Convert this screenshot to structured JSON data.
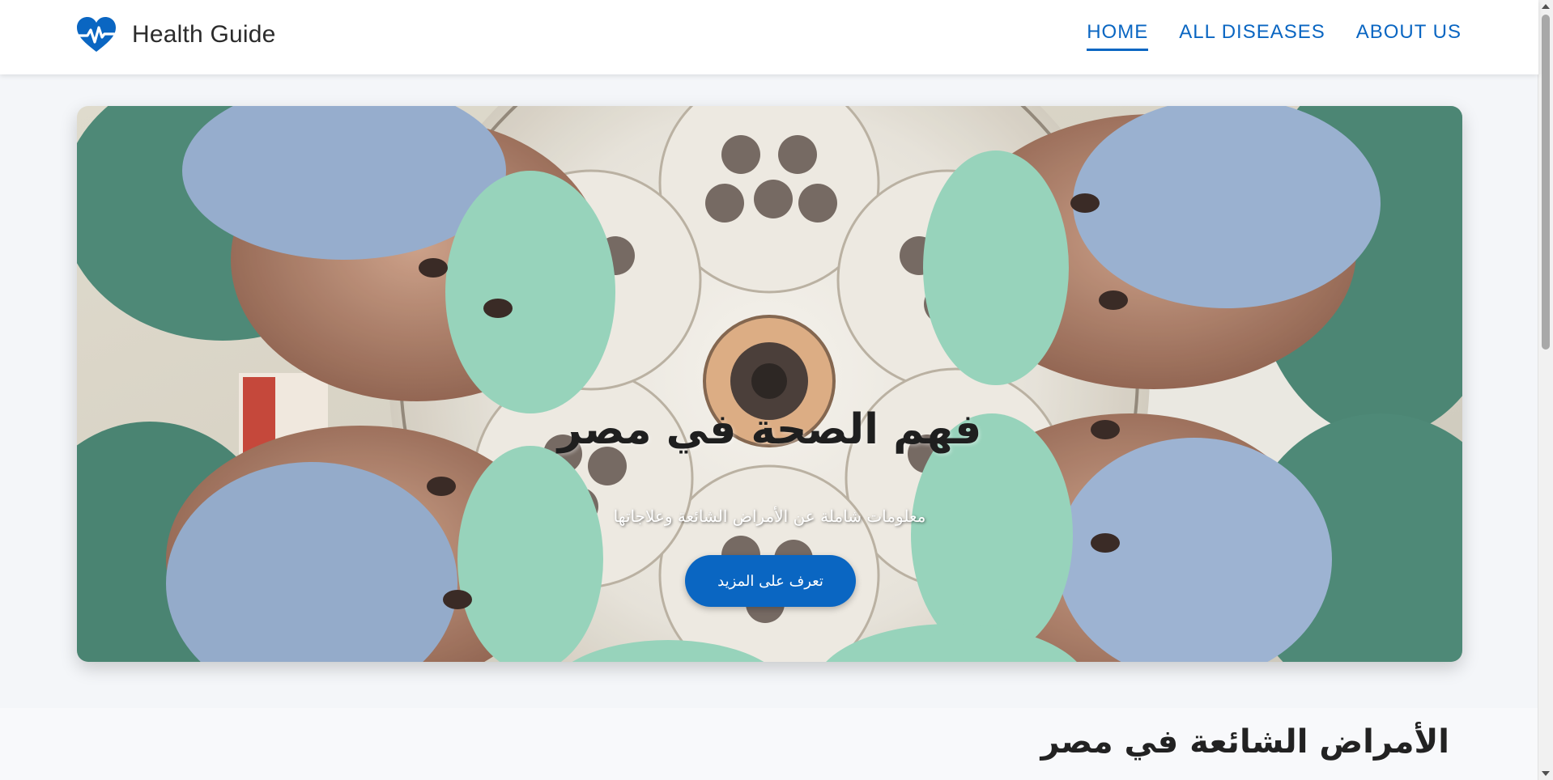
{
  "brand": {
    "name": "Health Guide",
    "icon": "heart-pulse-icon",
    "color": "#0a66c2"
  },
  "nav": {
    "items": [
      {
        "label": "HOME",
        "active": true
      },
      {
        "label": "ALL DISEASES",
        "active": false
      },
      {
        "label": "ABOUT US",
        "active": false
      }
    ]
  },
  "hero": {
    "title": "فهم الصحة في مصر",
    "subtitle": "معلومات شاملة عن الأمراض الشائعة وعلاجاتها",
    "button_label": "تعرف على المزيد",
    "image": "surgeons-looking-down-photo"
  },
  "section": {
    "title": "الأمراض الشائعة في مصر"
  },
  "colors": {
    "accent": "#0a66c2",
    "background": "#f4f6f9",
    "navbar": "#ffffff"
  }
}
